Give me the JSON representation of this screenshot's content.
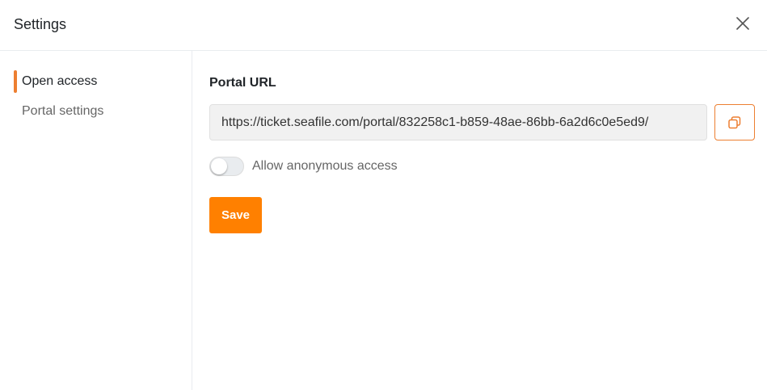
{
  "dialog": {
    "title": "Settings",
    "close_icon": "close-icon"
  },
  "sidebar": {
    "items": [
      {
        "label": "Open access",
        "active": true
      },
      {
        "label": "Portal settings",
        "active": false
      }
    ]
  },
  "main": {
    "portal_url_label": "Portal URL",
    "portal_url_value": "https://ticket.seafile.com/portal/832258c1-b859-48ae-86bb-6a2d6c0e5ed9/",
    "copy_icon": "copy-icon",
    "toggle_label": "Allow anonymous access",
    "toggle_on": false,
    "save_label": "Save"
  },
  "colors": {
    "accent": "#ed7f31",
    "save_button": "#ff8000"
  }
}
